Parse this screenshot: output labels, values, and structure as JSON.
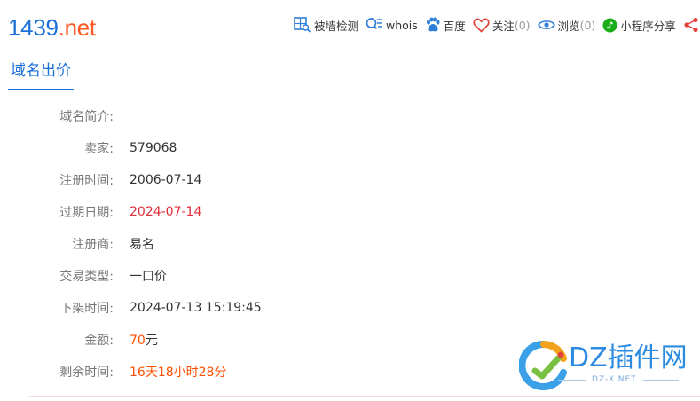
{
  "header": {
    "domain_name": "1439",
    "domain_tld": ".net"
  },
  "toolbar": {
    "blocked_check": "被墙检测",
    "whois": "whois",
    "baidu": "百度",
    "follow_label": "关注",
    "follow_count": "(0)",
    "views_label": "浏览",
    "views_count": "(0)",
    "miniprogram": "小程序分享",
    "share": "分"
  },
  "tabs": {
    "active": "域名出价"
  },
  "info": {
    "intro_label": "域名简介:",
    "intro_value": "",
    "seller_label": "卖家:",
    "seller_value": "579068",
    "reg_time_label": "注册时间:",
    "reg_time_value": "2006-07-14",
    "expire_label": "过期日期:",
    "expire_value": "2024-07-14",
    "registrar_label": "注册商:",
    "registrar_value": "易名",
    "trade_type_label": "交易类型:",
    "trade_type_value": "一口价",
    "delist_label": "下架时间:",
    "delist_value": "2024-07-13 15:19:45",
    "price_label": "金额:",
    "price_amount": "70",
    "price_unit": "元",
    "remaining_label": "剩余时间:",
    "remaining_value": "16天18小时28分"
  },
  "watermark": {
    "text": "DZ插件网",
    "sub": "DZ-X.NET"
  },
  "colors": {
    "accent": "#1a6fd8",
    "tld": "#ff5722",
    "expire_red": "#e0303a",
    "price_orange": "#ff5000",
    "label_gray": "#777777",
    "follow_heart": "#e2453c",
    "wechat_green": "#1aad19",
    "share_red": "#e2453c"
  },
  "icons": [
    "blocked-check-icon",
    "whois-icon",
    "baidu-paw-icon",
    "heart-icon",
    "eye-icon",
    "miniprogram-icon",
    "share-icon"
  ]
}
